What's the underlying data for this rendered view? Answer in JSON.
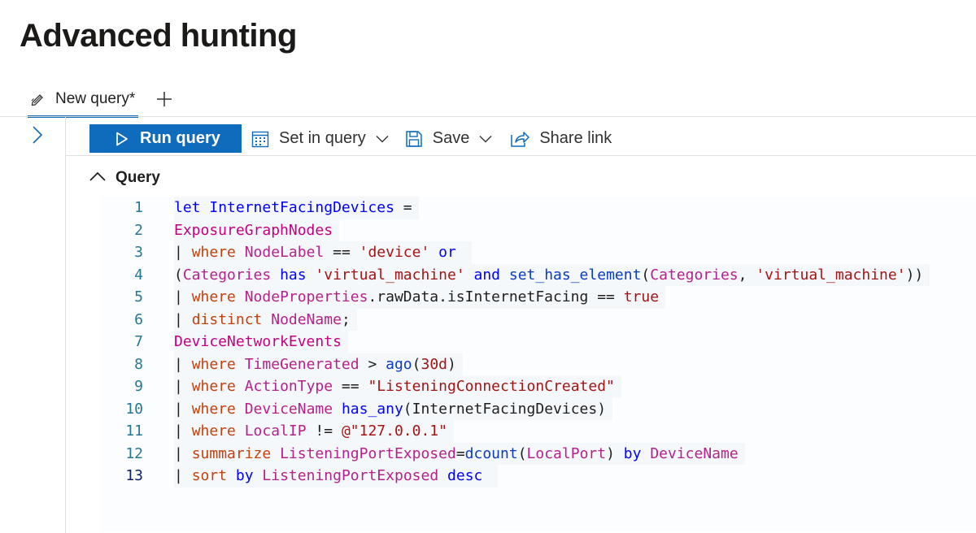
{
  "page": {
    "title": "Advanced hunting"
  },
  "tabs": [
    {
      "label": "New query*",
      "icon": "edit-icon",
      "active": true
    }
  ],
  "add_tab_icon": "plus-icon",
  "toolbar": {
    "run_label": "Run query",
    "set_in_query_label": "Set in query",
    "save_label": "Save",
    "share_label": "Share link"
  },
  "query_section": {
    "label": "Query",
    "expanded": true
  },
  "editor": {
    "current_line": 13,
    "lines": [
      {
        "n": "1",
        "tokens": [
          {
            "t": "let",
            "c": "kw"
          },
          {
            "t": " InternetFacingDevices ",
            "c": "kw"
          },
          {
            "t": "=",
            "c": ""
          }
        ]
      },
      {
        "n": "2",
        "tokens": [
          {
            "t": "ExposureGraphNodes",
            "c": "tbl"
          }
        ]
      },
      {
        "n": "3",
        "tokens": [
          {
            "t": "| ",
            "c": ""
          },
          {
            "t": "where",
            "c": "op"
          },
          {
            "t": " ",
            "c": ""
          },
          {
            "t": "NodeLabel",
            "c": "col"
          },
          {
            "t": " == ",
            "c": ""
          },
          {
            "t": "'device'",
            "c": "str"
          },
          {
            "t": " ",
            "c": ""
          },
          {
            "t": "or",
            "c": "kw"
          },
          {
            "t": " ",
            "c": ""
          }
        ]
      },
      {
        "n": "4",
        "tokens": [
          {
            "t": "(",
            "c": ""
          },
          {
            "t": "Categories",
            "c": "col"
          },
          {
            "t": " ",
            "c": ""
          },
          {
            "t": "has",
            "c": "kw"
          },
          {
            "t": " ",
            "c": ""
          },
          {
            "t": "'virtual_machine'",
            "c": "str"
          },
          {
            "t": " ",
            "c": ""
          },
          {
            "t": "and",
            "c": "kw"
          },
          {
            "t": " ",
            "c": ""
          },
          {
            "t": "set_has_element",
            "c": "fn"
          },
          {
            "t": "(",
            "c": ""
          },
          {
            "t": "Categories",
            "c": "col"
          },
          {
            "t": ", ",
            "c": ""
          },
          {
            "t": "'virtual_machine'",
            "c": "str"
          },
          {
            "t": "))",
            "c": ""
          }
        ]
      },
      {
        "n": "5",
        "tokens": [
          {
            "t": "| ",
            "c": ""
          },
          {
            "t": "where",
            "c": "op"
          },
          {
            "t": " ",
            "c": ""
          },
          {
            "t": "NodeProperties",
            "c": "col"
          },
          {
            "t": ".rawData.isInternetFacing == ",
            "c": ""
          },
          {
            "t": "true",
            "c": "str"
          }
        ]
      },
      {
        "n": "6",
        "tokens": [
          {
            "t": "| ",
            "c": ""
          },
          {
            "t": "distinct",
            "c": "op"
          },
          {
            "t": " ",
            "c": ""
          },
          {
            "t": "NodeName",
            "c": "col"
          },
          {
            "t": ";",
            "c": ""
          }
        ]
      },
      {
        "n": "7",
        "tokens": [
          {
            "t": "DeviceNetworkEvents",
            "c": "tbl"
          }
        ]
      },
      {
        "n": "8",
        "tokens": [
          {
            "t": "| ",
            "c": ""
          },
          {
            "t": "where",
            "c": "op"
          },
          {
            "t": " ",
            "c": ""
          },
          {
            "t": "TimeGenerated",
            "c": "col"
          },
          {
            "t": " > ",
            "c": ""
          },
          {
            "t": "ago",
            "c": "fn"
          },
          {
            "t": "(",
            "c": ""
          },
          {
            "t": "30d",
            "c": "str"
          },
          {
            "t": ")",
            "c": ""
          }
        ]
      },
      {
        "n": "9",
        "tokens": [
          {
            "t": "| ",
            "c": ""
          },
          {
            "t": "where",
            "c": "op"
          },
          {
            "t": " ",
            "c": ""
          },
          {
            "t": "ActionType",
            "c": "col"
          },
          {
            "t": " == ",
            "c": ""
          },
          {
            "t": "\"ListeningConnectionCreated\"",
            "c": "str"
          }
        ]
      },
      {
        "n": "10",
        "tokens": [
          {
            "t": "| ",
            "c": ""
          },
          {
            "t": "where",
            "c": "op"
          },
          {
            "t": " ",
            "c": ""
          },
          {
            "t": "DeviceName",
            "c": "col"
          },
          {
            "t": " ",
            "c": ""
          },
          {
            "t": "has_any",
            "c": "kw"
          },
          {
            "t": "(InternetFacingDevices)",
            "c": ""
          }
        ]
      },
      {
        "n": "11",
        "tokens": [
          {
            "t": "| ",
            "c": ""
          },
          {
            "t": "where",
            "c": "op"
          },
          {
            "t": " ",
            "c": ""
          },
          {
            "t": "LocalIP",
            "c": "col"
          },
          {
            "t": " != ",
            "c": ""
          },
          {
            "t": "@\"127.0.0.1\"",
            "c": "str"
          }
        ]
      },
      {
        "n": "12",
        "tokens": [
          {
            "t": "| ",
            "c": ""
          },
          {
            "t": "summarize",
            "c": "op"
          },
          {
            "t": " ",
            "c": ""
          },
          {
            "t": "ListeningPortExposed",
            "c": "col"
          },
          {
            "t": "=",
            "c": ""
          },
          {
            "t": "dcount",
            "c": "fn"
          },
          {
            "t": "(",
            "c": ""
          },
          {
            "t": "LocalPort",
            "c": "col"
          },
          {
            "t": ") ",
            "c": ""
          },
          {
            "t": "by",
            "c": "kw"
          },
          {
            "t": " ",
            "c": ""
          },
          {
            "t": "DeviceName",
            "c": "col"
          }
        ]
      },
      {
        "n": "13",
        "tokens": [
          {
            "t": "| ",
            "c": ""
          },
          {
            "t": "sort",
            "c": "op"
          },
          {
            "t": " ",
            "c": ""
          },
          {
            "t": "by",
            "c": "kw"
          },
          {
            "t": " ",
            "c": ""
          },
          {
            "t": "ListeningPortExposed",
            "c": "col"
          },
          {
            "t": " ",
            "c": ""
          },
          {
            "t": "desc",
            "c": "kw"
          },
          {
            "t": " ",
            "c": ""
          }
        ]
      }
    ]
  },
  "colors": {
    "accent": "#0f6cbd",
    "line_number": "#237893",
    "keyword": "#0000ff",
    "table": "#c40081",
    "operator": "#c2410c",
    "string": "#a31515"
  }
}
